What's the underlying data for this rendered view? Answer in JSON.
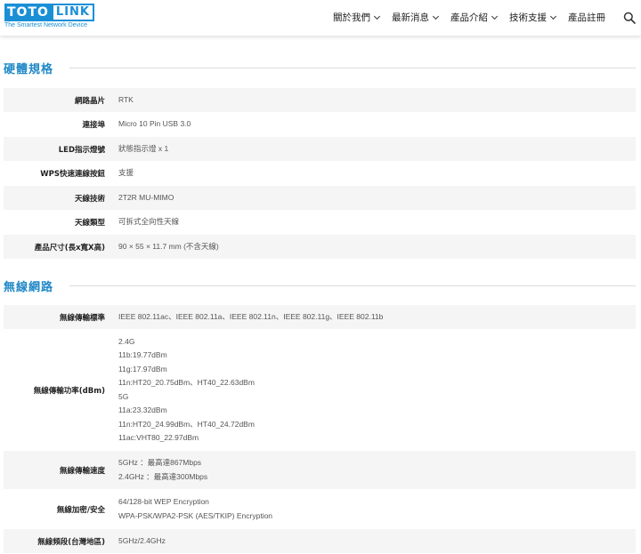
{
  "brand": {
    "left": "TOTO",
    "right": "LINK",
    "tagline": "The Smartest Network Device"
  },
  "nav": [
    {
      "label": "關於我們",
      "dropdown": true
    },
    {
      "label": "最新消息",
      "dropdown": true
    },
    {
      "label": "產品介紹",
      "dropdown": true
    },
    {
      "label": "技術支援",
      "dropdown": true
    },
    {
      "label": "產品註冊",
      "dropdown": false
    }
  ],
  "sections": [
    {
      "title": "硬體規格",
      "rows": [
        {
          "label": "網路晶片",
          "lines": [
            "RTK"
          ]
        },
        {
          "label": "連接埠",
          "lines": [
            "Micro 10 Pin USB 3.0"
          ]
        },
        {
          "label": "LED指示燈號",
          "lines": [
            "狀態指示燈 x 1"
          ]
        },
        {
          "label": "WPS快速連線按鈕",
          "lines": [
            "支援"
          ]
        },
        {
          "label": "天線技術",
          "lines": [
            "2T2R MU-MIMO"
          ]
        },
        {
          "label": "天線類型",
          "lines": [
            "可拆式全向性天線"
          ]
        },
        {
          "label": "產品尺寸(長x寬X高)",
          "lines": [
            "90 × 55 × 11.7 mm (不含天線)"
          ]
        }
      ]
    },
    {
      "title": "無線網路",
      "rows": [
        {
          "label": "無線傳輸標準",
          "lines": [
            "IEEE 802.11ac、IEEE 802.11a、IEEE 802.11n、IEEE 802.11g、IEEE 802.11b"
          ]
        },
        {
          "label": "無線傳輸功率(dBm)",
          "lines": [
            "2.4G",
            "11b:19.77dBm",
            "11g:17.97dBm",
            "11n:HT20_20.75dBm、HT40_22.63dBm",
            "5G",
            "11a:23.32dBm",
            "11n:HT20_24.99dBm、HT40_24.72dBm",
            "11ac:VHT80_22.97dBm"
          ]
        },
        {
          "label": "無線傳輸速度",
          "lines": [
            "5GHz ：最高達867Mbps",
            "2.4GHz ：最高達300Mbps"
          ]
        },
        {
          "label": "無線加密/安全",
          "lines": [
            "64/128-bit WEP Encryption",
            "WPA-PSK/WPA2-PSK (AES/TKIP) Encryption"
          ]
        },
        {
          "label": "無線頻段(台灣地區)",
          "lines": [
            "5GHz/2.4GHz"
          ]
        }
      ]
    }
  ]
}
